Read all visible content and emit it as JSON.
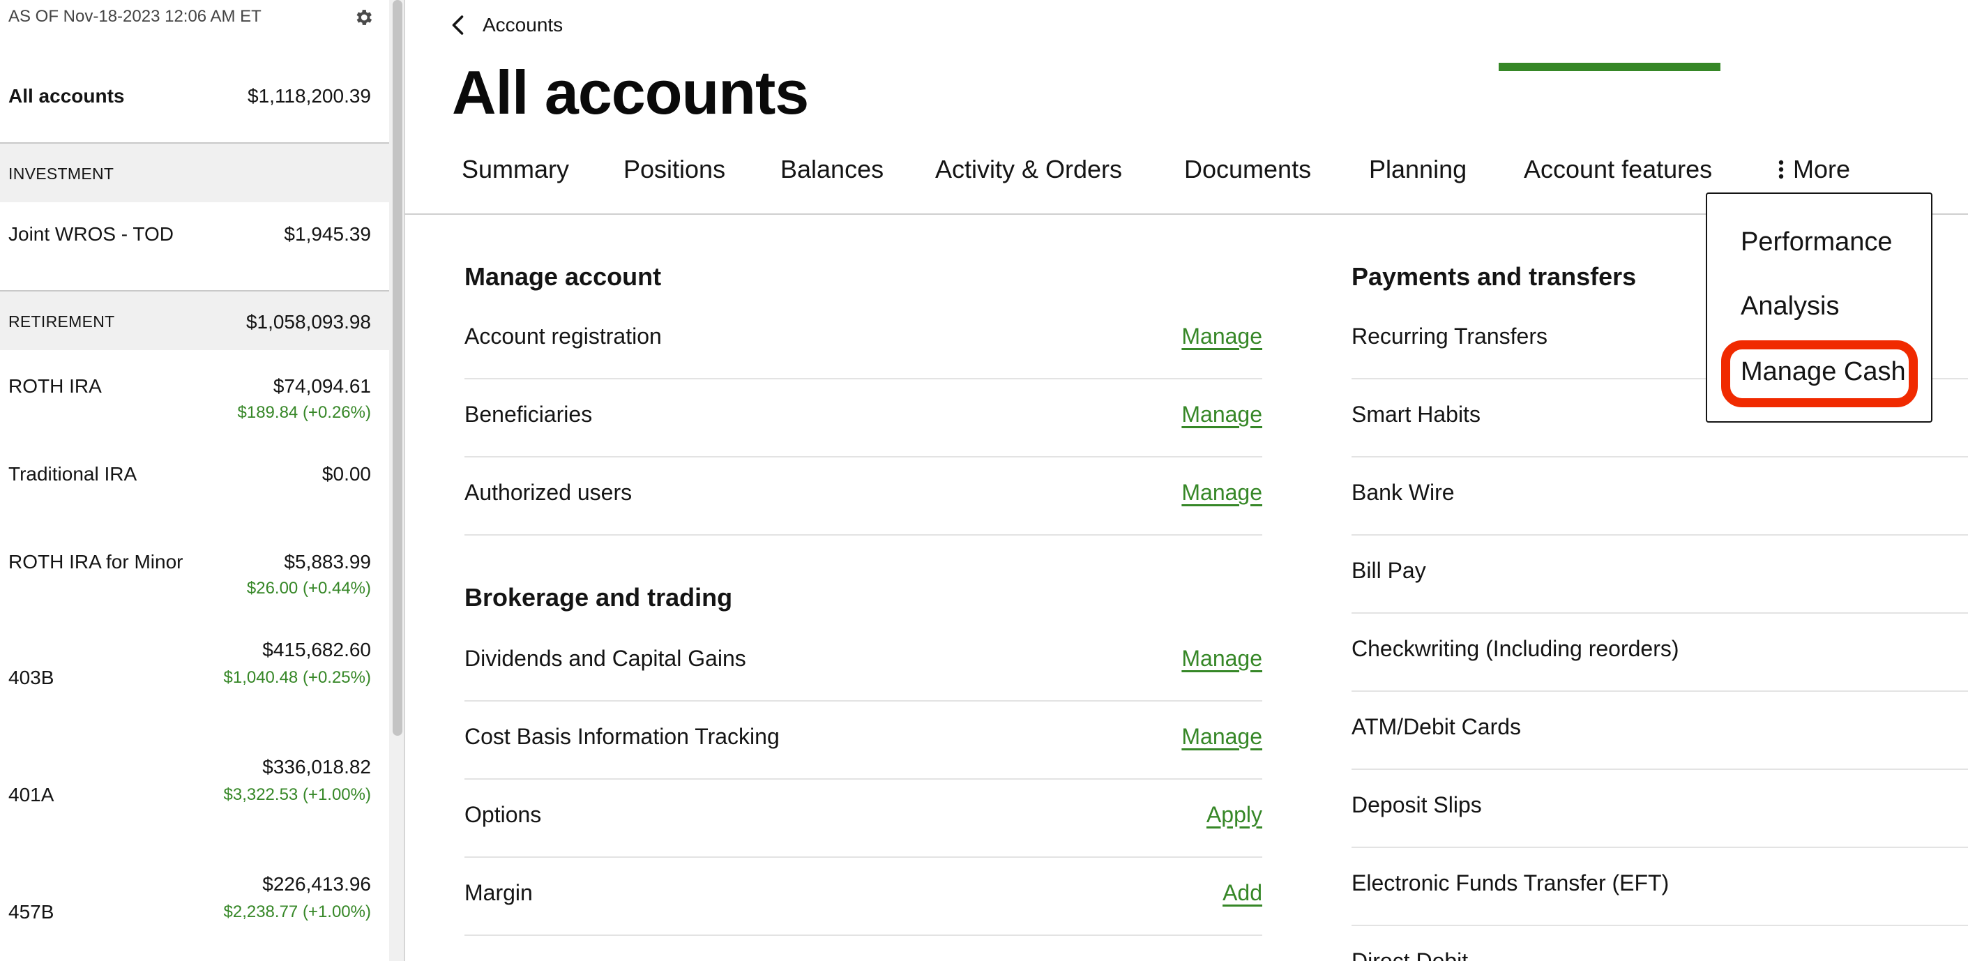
{
  "sidebar": {
    "as_of": "AS OF Nov-18-2023 12:06 AM ET",
    "settings_icon": "gear-icon",
    "all_accounts": {
      "label": "All accounts",
      "value": "$1,118,200.39"
    },
    "investment": {
      "label": "INVESTMENT",
      "accounts": [
        {
          "name": "Joint WROS - TOD",
          "value": "$1,945.39"
        }
      ]
    },
    "retirement": {
      "label": "RETIREMENT",
      "value": "$1,058,093.98",
      "accounts": [
        {
          "name": "ROTH IRA",
          "value": "$74,094.61",
          "change": "$189.84 (+0.26%)"
        },
        {
          "name": "Traditional IRA",
          "value": "$0.00",
          "change": ""
        },
        {
          "name": "ROTH IRA for Minor",
          "value": "$5,883.99",
          "change": "$26.00 (+0.44%)"
        },
        {
          "name": "403B",
          "value": "$415,682.60",
          "change": "$1,040.48 (+0.25%)"
        },
        {
          "name": "401A",
          "value": "$336,018.82",
          "change": "$3,322.53 (+1.00%)"
        },
        {
          "name": "457B",
          "value": "$226,413.96",
          "change": "$2,238.77 (+1.00%)"
        }
      ]
    }
  },
  "header": {
    "back_label": "Accounts",
    "back_icon": "chevron-left-icon",
    "title": "All accounts"
  },
  "tabs": {
    "items": [
      "Summary",
      "Positions",
      "Balances",
      "Activity & Orders",
      "Documents",
      "Planning",
      "Account features"
    ],
    "active": "Account features",
    "more_label": "More",
    "more_icon": "vertical-dots-icon"
  },
  "more_menu": {
    "items": [
      "Performance",
      "Analysis",
      "Manage Cash"
    ],
    "highlighted": "Manage Cash"
  },
  "manage_account": {
    "title": "Manage account",
    "rows": [
      {
        "label": "Account registration",
        "action": "Manage"
      },
      {
        "label": "Beneficiaries",
        "action": "Manage"
      },
      {
        "label": "Authorized users",
        "action": "Manage"
      }
    ]
  },
  "brokerage": {
    "title": "Brokerage and trading",
    "rows": [
      {
        "label": "Dividends and Capital Gains",
        "action": "Manage"
      },
      {
        "label": "Cost Basis Information Tracking",
        "action": "Manage"
      },
      {
        "label": "Options",
        "action": "Apply"
      },
      {
        "label": "Margin",
        "action": "Add"
      }
    ]
  },
  "payments": {
    "title": "Payments and transfers",
    "rows": [
      "Recurring Transfers",
      "Smart Habits",
      "Bank Wire",
      "Bill Pay",
      "Checkwriting (Including reorders)",
      "ATM/Debit Cards",
      "Deposit Slips",
      "Electronic Funds Transfer (EFT)",
      "Direct Debit"
    ]
  },
  "colors": {
    "accent_green": "#368727",
    "highlight_red": "#f02a00",
    "section_bg": "#f0f0f0"
  }
}
